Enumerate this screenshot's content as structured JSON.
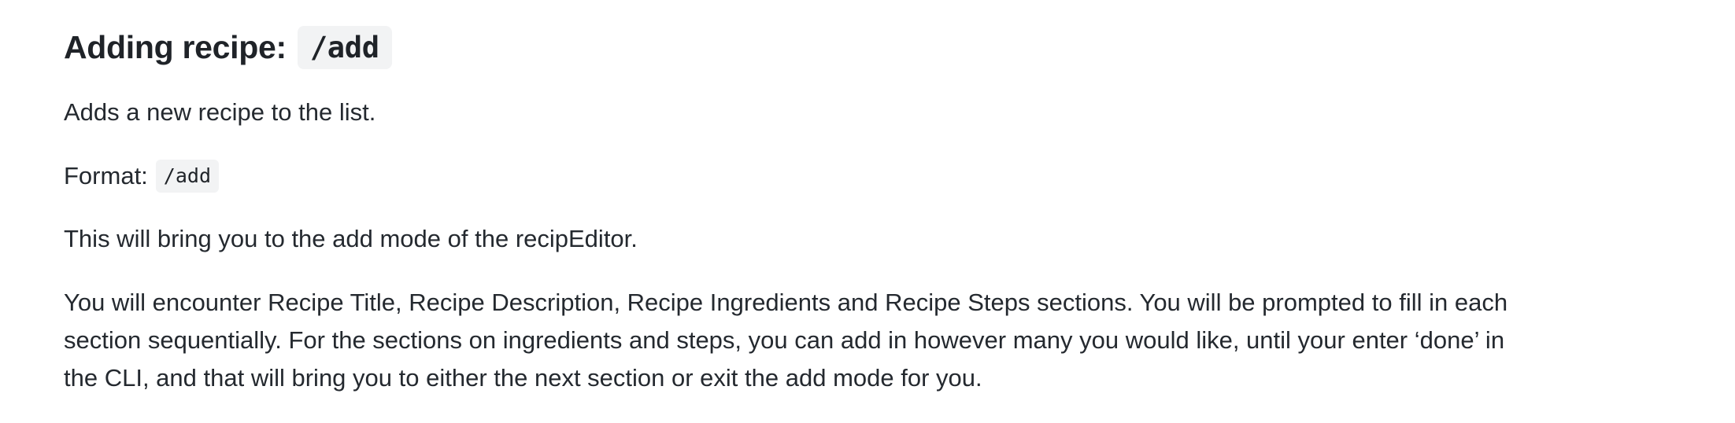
{
  "section": {
    "heading_text": "Adding recipe:",
    "heading_code": "/add",
    "description": "Adds a new recipe to the list.",
    "format_label": "Format:",
    "format_code": "/add",
    "mode_note": "This will bring you to the add mode of the recipEditor.",
    "details_lines": [
      "You will encounter Recipe Title, Recipe Description, Recipe Ingredients and Recipe Steps sections. You will be prompted to fill in each",
      "section sequentially. For the sections on ingredients and steps, you can add in however many you would like, until your enter ‘done’ in",
      "the CLI, and that will bring you to either the next section or exit the add mode for you."
    ]
  }
}
